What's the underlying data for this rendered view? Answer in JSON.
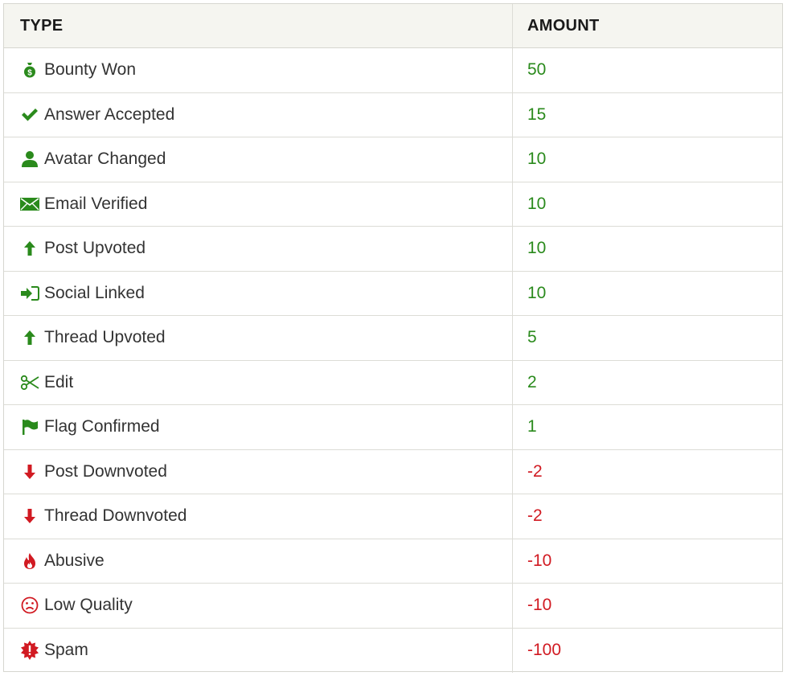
{
  "columns": {
    "type": "TYPE",
    "amount": "AMOUNT"
  },
  "colors": {
    "positive": "#2a8a1c",
    "negative": "#d11a22",
    "header_bg": "#f5f5f0"
  },
  "rows": [
    {
      "label": "Bounty Won",
      "amount": "50",
      "icon": "money-bag-icon",
      "sign": "pos"
    },
    {
      "label": "Answer Accepted",
      "amount": "15",
      "icon": "checkmark-icon",
      "sign": "pos"
    },
    {
      "label": "Avatar Changed",
      "amount": "10",
      "icon": "user-icon",
      "sign": "pos"
    },
    {
      "label": "Email Verified",
      "amount": "10",
      "icon": "envelope-icon",
      "sign": "pos"
    },
    {
      "label": "Post Upvoted",
      "amount": "10",
      "icon": "arrow-up-icon",
      "sign": "pos"
    },
    {
      "label": "Social Linked",
      "amount": "10",
      "icon": "sign-in-icon",
      "sign": "pos"
    },
    {
      "label": "Thread Upvoted",
      "amount": "5",
      "icon": "arrow-up-icon",
      "sign": "pos"
    },
    {
      "label": "Edit",
      "amount": "2",
      "icon": "scissors-icon",
      "sign": "pos"
    },
    {
      "label": "Flag Confirmed",
      "amount": "1",
      "icon": "flag-icon",
      "sign": "pos"
    },
    {
      "label": "Post Downvoted",
      "amount": "-2",
      "icon": "arrow-down-icon",
      "sign": "neg"
    },
    {
      "label": "Thread Downvoted",
      "amount": "-2",
      "icon": "arrow-down-icon",
      "sign": "neg"
    },
    {
      "label": "Abusive",
      "amount": "-10",
      "icon": "fire-icon",
      "sign": "neg"
    },
    {
      "label": "Low Quality",
      "amount": "-10",
      "icon": "frown-icon",
      "sign": "neg"
    },
    {
      "label": "Spam",
      "amount": "-100",
      "icon": "spam-burst-icon",
      "sign": "neg"
    }
  ]
}
